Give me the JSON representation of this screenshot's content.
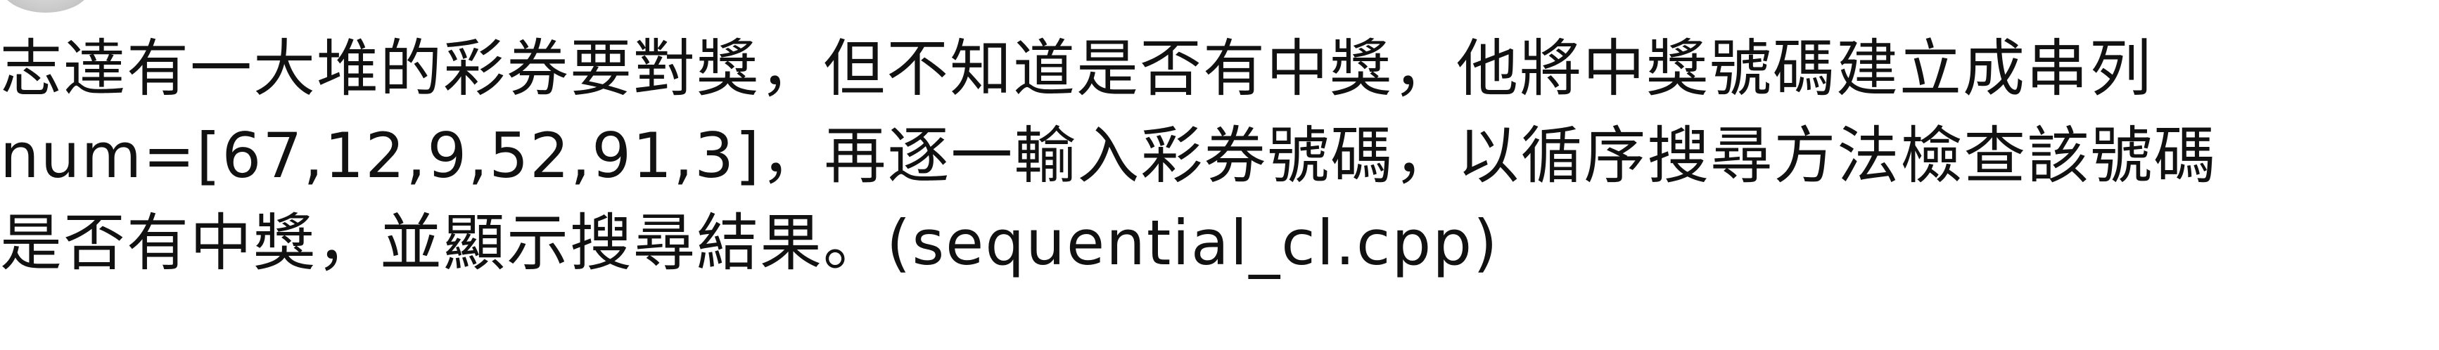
{
  "document": {
    "lines": [
      "志達有一大堆的彩券要對獎，但不知道是否有中獎，他將中獎號碼建立成串列",
      "num=[67,12,9,52,91,3]，再逐一輸入彩券號碼，以循序搜尋方法檢查該號碼",
      "是否有中獎，並顯示搜尋結果。(sequential_cl.cpp)"
    ]
  }
}
